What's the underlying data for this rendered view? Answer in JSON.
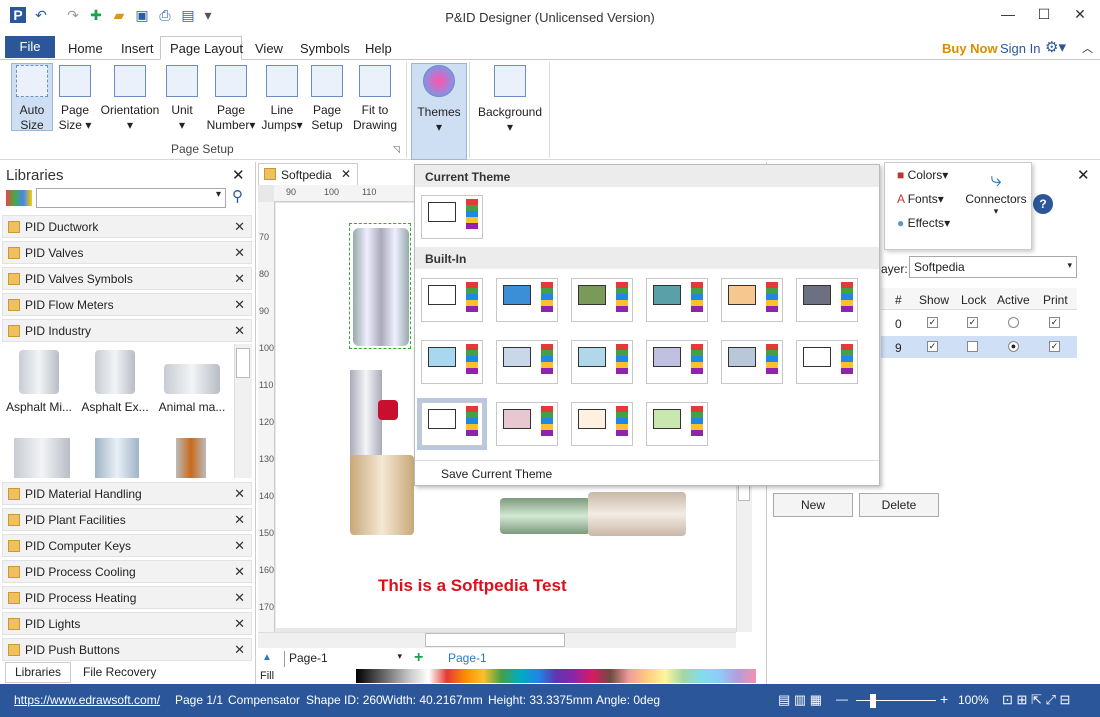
{
  "app": {
    "title": "P&ID Designer (Unlicensed Version)"
  },
  "menu": {
    "file": "File",
    "items": [
      "Home",
      "Insert",
      "Page Layout",
      "View",
      "Symbols",
      "Help"
    ],
    "buy_now": "Buy Now",
    "sign_in": "Sign In"
  },
  "ribbon": {
    "buttons": [
      {
        "line1": "Auto",
        "line2": "Size"
      },
      {
        "line1": "Page",
        "line2": "Size"
      },
      {
        "line1": "Orientation",
        "line2": ""
      },
      {
        "line1": "Unit",
        "line2": ""
      },
      {
        "line1": "Page",
        "line2": "Number"
      },
      {
        "line1": "Line",
        "line2": "Jumps"
      },
      {
        "line1": "Page",
        "line2": "Setup"
      },
      {
        "line1": "Fit to",
        "line2": "Drawing"
      }
    ],
    "group_label": "Page Setup",
    "themes": "Themes",
    "background": "Background"
  },
  "libraries": {
    "title": "Libraries",
    "items_top": [
      "PID Ductwork",
      "PID Valves",
      "PID Valves Symbols",
      "PID Flow Meters",
      "PID Industry"
    ],
    "shapes": [
      "Asphalt Mi...",
      "Asphalt Ex...",
      "Animal ma..."
    ],
    "items_bottom": [
      "PID Material Handling",
      "PID Plant Facilities",
      "PID Computer Keys",
      "PID Process Cooling",
      "PID Process Heating",
      "PID Lights",
      "PID Push Buttons"
    ],
    "tab_libraries": "Libraries",
    "tab_recovery": "File Recovery"
  },
  "document": {
    "tab": "Softpedia",
    "ruler_h": [
      "90",
      "100",
      "110"
    ],
    "ruler_v": [
      "70",
      "80",
      "90",
      "100",
      "110",
      "120",
      "130",
      "140",
      "150",
      "160",
      "170"
    ],
    "test_text": "This is a Softpedia Test"
  },
  "themes_menu": {
    "current_header": "Current Theme",
    "builtin_header": "Built-In",
    "save": "Save Current Theme",
    "colors": [
      "#e53935",
      "#43a047",
      "#1e88e5",
      "#fbc02d",
      "#8e24aa",
      "#fb8c00"
    ]
  },
  "format_popup": {
    "colors": "Colors",
    "fonts": "Fonts",
    "effects": "Effects",
    "connectors": "Connectors"
  },
  "layers": {
    "layer_label": "ayer:",
    "layer_value": "Softpedia",
    "headers": [
      "#",
      "Show",
      "Lock",
      "Active",
      "Print"
    ],
    "rows": [
      {
        "num": "0"
      },
      {
        "num": "9"
      }
    ],
    "new": "New",
    "delete": "Delete"
  },
  "pagebar": {
    "page_select": "Page-1",
    "page_tab": "Page-1",
    "fill": "Fill"
  },
  "status": {
    "url": "https://www.edrawsoft.com/",
    "page": "Page 1/1",
    "shape": "Compensator",
    "shape_id": "Shape ID: 260",
    "width": "Width: 40.2167mm",
    "height": "Height: 33.3375mm",
    "angle": "Angle: 0deg",
    "zoom": "100%"
  }
}
